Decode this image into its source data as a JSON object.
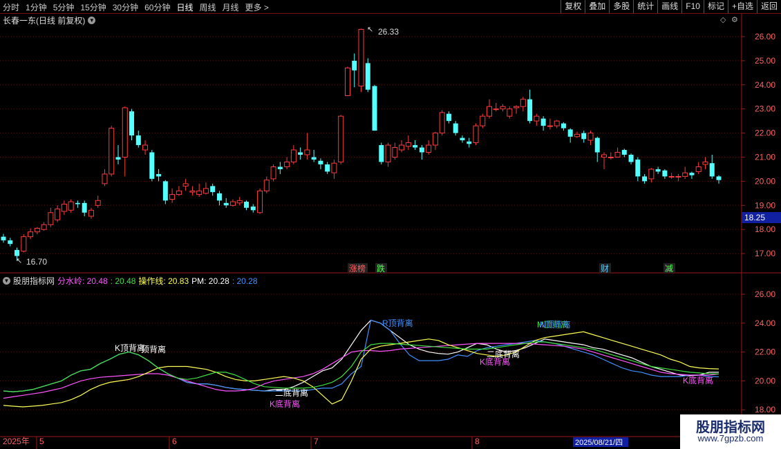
{
  "toolbar": {
    "left_items": [
      "分时",
      "1分钟",
      "5分钟",
      "15分钟",
      "30分钟",
      "60分钟",
      "日线",
      "周线",
      "月线",
      "更多 >"
    ],
    "active_left": "日线",
    "right_items": [
      "复权",
      "叠加",
      "多股",
      "统计",
      "画线",
      "F10",
      "标记",
      "+自选",
      "返回"
    ]
  },
  "stock_title": "长春一东(日线 前复权)",
  "main_chart": {
    "y_ticks": [
      "26.00",
      "25.00",
      "24.00",
      "23.00",
      "22.00",
      "21.00",
      "20.00",
      "19.00",
      "18.00",
      "17.00"
    ],
    "cursor_price": "18.25",
    "high_label": "26.33",
    "low_label": "16.70",
    "markers": [
      "涨榜",
      "跌",
      "财",
      "减"
    ]
  },
  "indicator": {
    "name": "股朋指标网",
    "fsl_label": "分水岭: 20.48",
    "fsl_value2": ": 20.48",
    "czx_label": "操作线: 20.83",
    "pm_label": "PM: 20.28",
    "pm_value2": ": 20.28",
    "y_ticks": [
      "26.00",
      "24.00",
      "22.00",
      "20.00",
      "18.00"
    ],
    "signals": [
      "K顶背离",
      "顶背离",
      "R顶背离",
      "M顶背离",
      "N顶背离",
      "二底背离",
      "K底背离",
      "K底背离",
      "K底背离",
      "K底背离"
    ]
  },
  "date_axis": {
    "year": "2025年",
    "months": [
      "5",
      "6",
      "7",
      "8"
    ],
    "cursor_date": "2025/08/21/四"
  },
  "watermark": {
    "line1": "股朋指标网",
    "line2": "www.7gpzb.com"
  },
  "colors": {
    "up": "#ff3c3c",
    "down": "#54ffff",
    "purple": "#ff54ff",
    "yellow": "#ffff54",
    "green": "#40e040",
    "blue": "#4090ff"
  },
  "candles": [
    [
      17.7,
      17.55,
      17.82,
      17.45
    ],
    [
      17.55,
      17.4,
      17.65,
      17.3
    ],
    [
      17.15,
      16.9,
      17.25,
      16.7
    ],
    [
      17.1,
      17.7,
      17.8,
      17.05
    ],
    [
      17.7,
      17.9,
      18.05,
      17.6
    ],
    [
      17.9,
      18.05,
      18.1,
      17.8
    ],
    [
      18.0,
      18.2,
      18.3,
      17.95
    ],
    [
      18.2,
      18.7,
      18.9,
      18.1
    ],
    [
      18.4,
      18.85,
      19.0,
      18.3
    ],
    [
      18.75,
      19.05,
      19.2,
      18.6
    ],
    [
      18.8,
      19.15,
      19.25,
      18.7
    ],
    [
      19.1,
      19.05,
      19.2,
      18.9
    ],
    [
      19.1,
      18.7,
      19.2,
      18.55
    ],
    [
      18.55,
      18.8,
      18.9,
      18.45
    ],
    [
      19.0,
      19.2,
      19.4,
      18.9
    ],
    [
      19.9,
      20.3,
      20.5,
      19.8
    ],
    [
      20.3,
      22.2,
      22.3,
      20.2
    ],
    [
      21.0,
      20.9,
      21.5,
      20.7
    ],
    [
      21.0,
      23.05,
      23.1,
      20.2
    ],
    [
      22.9,
      21.9,
      23.0,
      21.7
    ],
    [
      21.9,
      21.5,
      22.1,
      21.4
    ],
    [
      21.3,
      21.5,
      21.7,
      21.1
    ],
    [
      21.2,
      20.1,
      21.3,
      20.0
    ],
    [
      20.3,
      20.2,
      20.5,
      20.0
    ],
    [
      20.0,
      19.2,
      20.05,
      19.05
    ],
    [
      19.25,
      19.45,
      19.7,
      19.1
    ],
    [
      19.45,
      19.6,
      19.8,
      19.4
    ],
    [
      19.8,
      19.9,
      20.1,
      19.6
    ],
    [
      19.55,
      19.6,
      19.8,
      19.4
    ],
    [
      19.45,
      19.6,
      19.9,
      19.35
    ],
    [
      19.5,
      19.7,
      19.95,
      19.45
    ],
    [
      19.8,
      19.55,
      19.9,
      19.4
    ],
    [
      19.5,
      19.2,
      19.6,
      19.0
    ],
    [
      19.1,
      19.0,
      19.3,
      18.9
    ],
    [
      19.0,
      19.15,
      19.25,
      18.95
    ],
    [
      19.1,
      19.2,
      19.35,
      19.0
    ],
    [
      19.15,
      18.9,
      19.2,
      18.8
    ],
    [
      18.95,
      18.8,
      19.05,
      18.7
    ],
    [
      18.7,
      19.6,
      19.7,
      18.65
    ],
    [
      19.6,
      20.05,
      20.2,
      19.5
    ],
    [
      20.1,
      20.6,
      20.7,
      20.0
    ],
    [
      20.6,
      20.5,
      20.8,
      20.3
    ],
    [
      20.6,
      20.8,
      21.0,
      20.5
    ],
    [
      20.8,
      21.3,
      21.5,
      20.7
    ],
    [
      21.2,
      21.1,
      21.4,
      20.9
    ],
    [
      21.1,
      21.3,
      22.0,
      20.9
    ],
    [
      21.0,
      20.9,
      21.3,
      20.8
    ],
    [
      20.85,
      20.7,
      20.95,
      20.5
    ],
    [
      20.7,
      20.4,
      20.8,
      20.3
    ],
    [
      20.35,
      20.75,
      20.9,
      20.1
    ],
    [
      20.8,
      22.7,
      22.75,
      20.7
    ],
    [
      23.55,
      24.7,
      24.75,
      23.55
    ],
    [
      25.0,
      24.6,
      25.3,
      23.9
    ],
    [
      23.95,
      26.3,
      26.33,
      23.7
    ],
    [
      24.9,
      23.8,
      25.1,
      23.7
    ],
    [
      23.95,
      22.1,
      24.0,
      22.1
    ],
    [
      21.5,
      20.8,
      21.6,
      20.7
    ],
    [
      20.8,
      21.5,
      21.6,
      20.6
    ],
    [
      21.0,
      21.4,
      21.6,
      20.9
    ],
    [
      21.3,
      21.5,
      21.7,
      21.2
    ],
    [
      21.45,
      21.6,
      21.9,
      21.3
    ],
    [
      21.5,
      21.4,
      21.7,
      21.3
    ],
    [
      21.4,
      21.2,
      21.5,
      20.9
    ],
    [
      21.2,
      21.5,
      21.7,
      21.1
    ],
    [
      21.5,
      22.0,
      22.05,
      21.3
    ],
    [
      22.0,
      22.85,
      22.95,
      21.9
    ],
    [
      22.8,
      22.5,
      22.9,
      22.4
    ],
    [
      22.4,
      22.0,
      22.5,
      21.9
    ],
    [
      21.8,
      21.7,
      21.9,
      21.6
    ],
    [
      21.65,
      21.55,
      21.8,
      21.4
    ],
    [
      21.6,
      22.3,
      22.4,
      21.5
    ],
    [
      22.3,
      22.7,
      22.8,
      22.2
    ],
    [
      22.7,
      23.1,
      23.4,
      22.6
    ],
    [
      23.0,
      23.0,
      23.25,
      22.9
    ],
    [
      23.0,
      23.1,
      23.2,
      22.9
    ],
    [
      22.7,
      23.0,
      23.1,
      22.6
    ],
    [
      23.05,
      23.1,
      23.15,
      22.8
    ],
    [
      23.1,
      23.4,
      23.5,
      22.9
    ],
    [
      23.4,
      22.5,
      23.8,
      22.4
    ],
    [
      22.5,
      22.7,
      22.8,
      22.3
    ],
    [
      22.6,
      22.3,
      22.7,
      22.1
    ],
    [
      22.3,
      22.3,
      22.6,
      22.15
    ],
    [
      22.3,
      22.5,
      22.55,
      22.2
    ],
    [
      22.4,
      22.2,
      22.45,
      22.1
    ],
    [
      22.15,
      21.85,
      22.2,
      21.6
    ],
    [
      21.85,
      21.95,
      22.05,
      21.8
    ],
    [
      22.0,
      21.75,
      22.1,
      21.6
    ],
    [
      21.7,
      22.0,
      22.1,
      21.5
    ],
    [
      21.8,
      21.2,
      21.85,
      20.8
    ],
    [
      21.0,
      21.1,
      21.2,
      20.5
    ],
    [
      21.0,
      21.0,
      21.2,
      20.9
    ],
    [
      21.0,
      21.2,
      21.4,
      21.0
    ],
    [
      21.3,
      21.1,
      21.35,
      21.0
    ],
    [
      21.1,
      20.8,
      21.15,
      20.7
    ],
    [
      20.9,
      20.2,
      21.0,
      20.0
    ],
    [
      20.2,
      20.0,
      20.3,
      19.9
    ],
    [
      20.1,
      20.5,
      20.55,
      19.95
    ],
    [
      20.5,
      20.4,
      20.6,
      20.3
    ],
    [
      20.45,
      20.2,
      20.5,
      20.1
    ],
    [
      20.2,
      20.2,
      20.35,
      20.1
    ],
    [
      20.2,
      20.2,
      20.3,
      20.0
    ],
    [
      20.2,
      20.35,
      20.6,
      20.1
    ],
    [
      20.35,
      20.25,
      20.4,
      20.1
    ],
    [
      20.4,
      20.6,
      20.8,
      20.3
    ],
    [
      20.7,
      20.8,
      21.0,
      20.5
    ],
    [
      20.75,
      20.2,
      21.1,
      20.1
    ],
    [
      20.2,
      20.05,
      20.25,
      19.9
    ]
  ],
  "indicator_series": [
    {
      "name": "PM",
      "color": "#ffffff",
      "values": [
        19.3,
        19.25,
        19.3,
        19.4,
        19.6,
        19.8,
        20.0,
        20.4,
        20.7,
        20.8,
        21.2,
        21.5,
        21.85,
        22.0,
        21.8,
        21.4,
        20.9,
        20.5,
        20.2,
        19.9,
        19.8,
        19.8,
        19.7,
        19.55,
        19.45,
        19.4,
        19.35,
        19.3,
        19.4,
        19.4,
        19.6,
        19.9,
        20.3,
        20.7,
        20.9,
        21.5,
        22.5,
        23.5,
        24.2,
        24.0,
        23.5,
        23.0,
        22.5,
        22.2,
        22.0,
        21.9,
        21.85,
        22.0,
        22.3,
        22.6,
        22.5,
        22.2,
        22.0,
        22.1,
        22.3,
        22.6,
        22.9,
        22.8,
        22.7,
        22.6,
        22.5,
        22.3,
        22.2,
        22.0,
        21.8,
        21.6,
        21.3,
        21.0,
        20.8,
        20.6,
        20.4,
        20.35,
        20.4,
        20.6,
        20.6
      ]
    },
    {
      "name": "PM2",
      "color": "#4090ff",
      "values": [
        19.3,
        19.25,
        19.3,
        19.4,
        19.6,
        19.8,
        20.0,
        20.4,
        20.7,
        20.8,
        21.2,
        21.5,
        21.85,
        22.0,
        21.8,
        21.4,
        20.9,
        20.5,
        20.2,
        19.9,
        19.8,
        19.8,
        19.7,
        19.55,
        19.45,
        19.4,
        19.35,
        19.3,
        19.3,
        19.3,
        19.3,
        19.3,
        19.4,
        19.5,
        19.5,
        19.8,
        20.5,
        21.0,
        24.2,
        24.0,
        23.5,
        22.6,
        21.8,
        21.4,
        21.4,
        21.4,
        21.5,
        21.8,
        21.7,
        22.1,
        22.3,
        22.4,
        22.5,
        22.6,
        22.7,
        22.8,
        22.7,
        22.6,
        22.4,
        22.2,
        22.0,
        21.8,
        21.5,
        21.2,
        20.9,
        20.7,
        20.6,
        20.4,
        20.3,
        20.3,
        20.3,
        20.4,
        20.4,
        20.3,
        20.28
      ]
    },
    {
      "name": "分水岭",
      "color": "#ff54ff",
      "values": [
        18.8,
        18.9,
        19.0,
        19.1,
        19.2,
        19.35,
        19.5,
        19.75,
        20.0,
        20.15,
        20.25,
        20.3,
        20.35,
        20.4,
        20.45,
        20.5,
        20.5,
        20.4,
        20.2,
        20.0,
        19.8,
        19.6,
        19.4,
        19.3,
        19.3,
        19.35,
        19.5,
        19.8,
        20.0,
        20.1,
        20.2,
        20.3,
        20.5,
        20.8,
        21.2,
        21.6,
        22.0,
        22.1,
        22.1,
        22.05,
        22.1,
        22.2,
        22.25,
        22.3,
        22.35,
        22.4,
        22.45,
        22.5,
        22.55,
        22.6,
        22.6,
        22.6,
        22.6,
        22.6,
        22.6,
        22.55,
        22.5,
        22.45,
        22.4,
        22.3,
        22.2,
        22.0,
        21.8,
        21.6,
        21.4,
        21.2,
        21.0,
        20.8,
        20.6,
        20.5,
        20.45,
        20.4,
        20.4,
        20.4,
        20.48
      ]
    },
    {
      "name": "操作线",
      "color": "#ffff54",
      "values": [
        18.3,
        18.25,
        18.2,
        18.25,
        18.3,
        18.4,
        18.5,
        18.7,
        19.0,
        19.4,
        19.7,
        19.9,
        20.0,
        20.1,
        20.3,
        20.6,
        20.9,
        21.0,
        21.0,
        21.0,
        20.9,
        20.8,
        20.6,
        20.3,
        20.1,
        20.0,
        20.0,
        20.1,
        20.2,
        20.3,
        20.2,
        20.0,
        19.6,
        19.0,
        18.4,
        18.7,
        20.0,
        21.5,
        22.2,
        22.4,
        22.5,
        22.6,
        22.7,
        22.8,
        22.9,
        22.8,
        22.5,
        22.3,
        22.1,
        21.9,
        21.8,
        21.7,
        21.8,
        22.0,
        22.4,
        22.8,
        23.0,
        23.1,
        23.2,
        23.3,
        23.4,
        23.2,
        23.0,
        22.8,
        22.6,
        22.4,
        22.2,
        22.0,
        21.8,
        21.5,
        21.3,
        21.0,
        20.9,
        20.85,
        20.83
      ]
    },
    {
      "name": "分水岭2",
      "color": "#40e040",
      "values": [
        19.3,
        19.25,
        19.3,
        19.4,
        19.6,
        19.8,
        20.0,
        20.4,
        20.7,
        20.8,
        21.2,
        21.5,
        21.85,
        22.0,
        21.8,
        21.4,
        20.9,
        20.5,
        20.2,
        20.1,
        20.2,
        20.4,
        20.6,
        20.6,
        20.4,
        20.1,
        19.8,
        19.6,
        19.55,
        19.5,
        19.5,
        19.5,
        19.55,
        19.7,
        19.9,
        20.3,
        21.0,
        22.0,
        22.5,
        22.6,
        22.6,
        22.55,
        22.5,
        22.45,
        22.4,
        22.35,
        22.3,
        22.25,
        22.2,
        22.2,
        22.2,
        22.3,
        22.4,
        22.5,
        22.6,
        22.7,
        22.7,
        22.6,
        22.5,
        22.4,
        22.3,
        22.2,
        22.0,
        21.8,
        21.6,
        21.4,
        21.2,
        21.0,
        20.9,
        20.8,
        20.7,
        20.6,
        20.55,
        20.5,
        20.48
      ]
    }
  ]
}
